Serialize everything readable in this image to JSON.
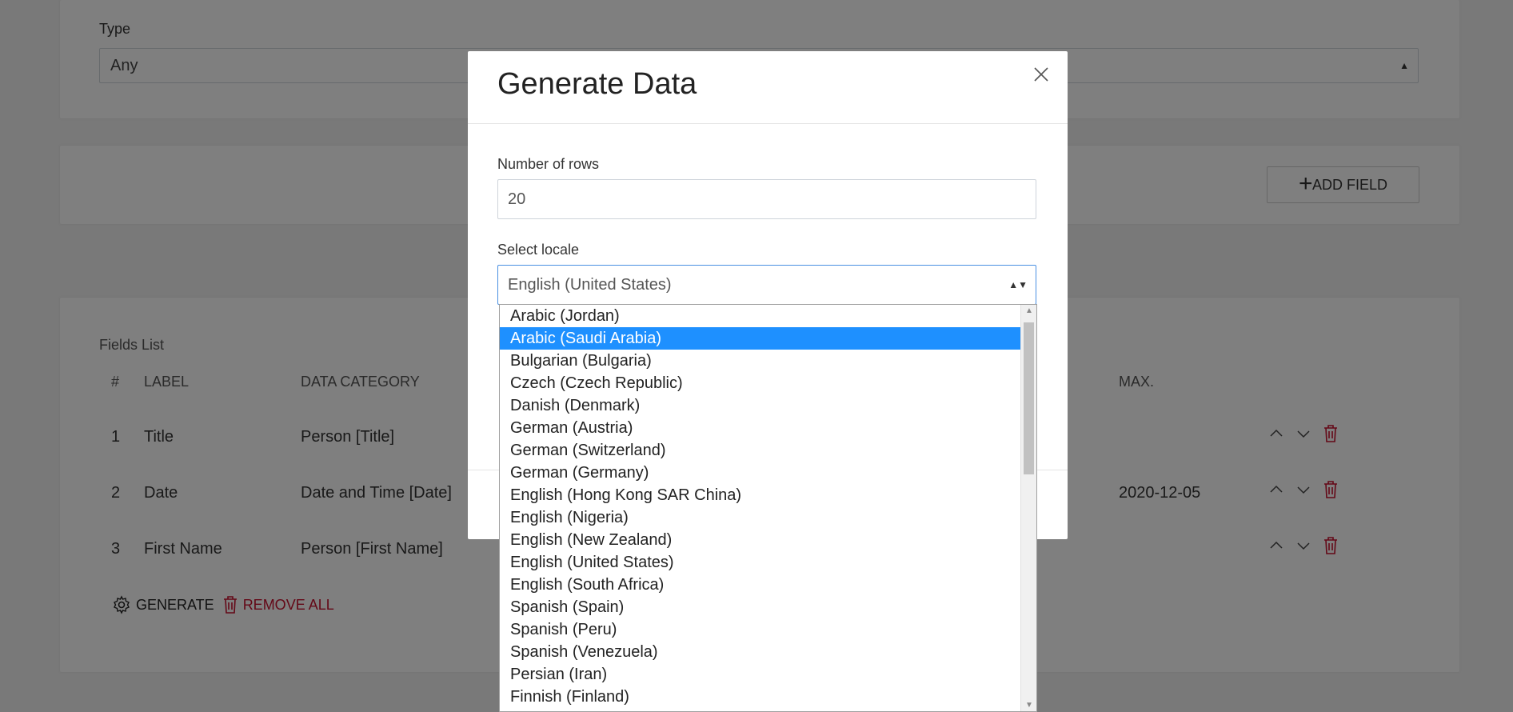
{
  "background": {
    "type_label": "Type",
    "type_value": "Any",
    "add_field_label": "ADD FIELD",
    "fields_list_title": "Fields List",
    "columns": [
      "#",
      "LABEL",
      "DATA CATEGORY",
      "MAX."
    ],
    "rows": [
      {
        "num": "1",
        "label": "Title",
        "category": "Person [Title]",
        "max": ""
      },
      {
        "num": "2",
        "label": "Date",
        "category": "Date and Time [Date]",
        "max": "2020-12-05"
      },
      {
        "num": "3",
        "label": "First Name",
        "category": "Person [First Name]",
        "max": ""
      }
    ],
    "generate_label": "GENERATE",
    "remove_all_label": "REMOVE ALL"
  },
  "modal": {
    "title": "Generate Data",
    "rows_label": "Number of rows",
    "rows_value": "20",
    "locale_label": "Select locale",
    "locale_value": "English (United States)"
  },
  "locale_options": [
    "Arabic (Jordan)",
    "Arabic (Saudi Arabia)",
    "Bulgarian (Bulgaria)",
    "Czech (Czech Republic)",
    "Danish (Denmark)",
    "German (Austria)",
    "German (Switzerland)",
    "German (Germany)",
    "English (Hong Kong SAR China)",
    "English (Nigeria)",
    "English (New Zealand)",
    "English (United States)",
    "English (South Africa)",
    "Spanish (Spain)",
    "Spanish (Peru)",
    "Spanish (Venezuela)",
    "Persian (Iran)",
    "Finnish (Finland)"
  ],
  "highlighted_option": "Arabic (Saudi Arabia)",
  "colors": {
    "accent": "#1e90ff",
    "danger": "#c8102e"
  }
}
